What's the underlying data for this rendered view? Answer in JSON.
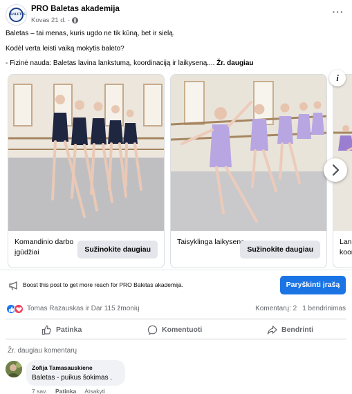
{
  "post": {
    "page_name": "PRO Baletas akademija",
    "date": "Kovas 21 d.",
    "separator": "·",
    "avatar_text": "BALETAS",
    "more_label": "···",
    "text_lines": [
      "Baletas – tai menas, kuris ugdo ne tik kūną, bet ir sielą.",
      "Kodėl verta leisti vaiką mokytis baleto?",
      "- Fizinė nauda: Baletas lavina lankstumą, koordinaciją ir laikyseną.... "
    ],
    "see_more": "Žr. daugiau"
  },
  "carousel": {
    "info_label": "i",
    "cards": [
      {
        "caption": "Komandinio darbo įgūdžiai",
        "cta": "Sužinokite daugiau"
      },
      {
        "caption": "Taisyklinga laikysena",
        "cta": "Sužinokite daugiau"
      },
      {
        "caption": "Lanks koord",
        "cta": ""
      }
    ]
  },
  "boost": {
    "text": "Boost this post to get more reach for PRO Baletas akademija.",
    "button": "Paryškinti įrašą",
    "button_color": "#1b74e4"
  },
  "reactions": {
    "names": "Tomas Razauskas ir Dar 115 žmonių",
    "comments": "Komentarų: 2",
    "shares": "1 bendrinimas",
    "like_color": "#1877f2",
    "love_color": "#f33e58"
  },
  "actions": {
    "like": "Patinka",
    "comment": "Komentuoti",
    "share": "Bendrinti"
  },
  "comments": {
    "view_more": "Žr. daugiau komentarų",
    "items": [
      {
        "author": "Zofija Tamasauskiene",
        "text": "Baletas - puikus šokimas .",
        "age": "7 sav.",
        "like": "Patinka",
        "reply": "Atsakyti"
      }
    ]
  }
}
